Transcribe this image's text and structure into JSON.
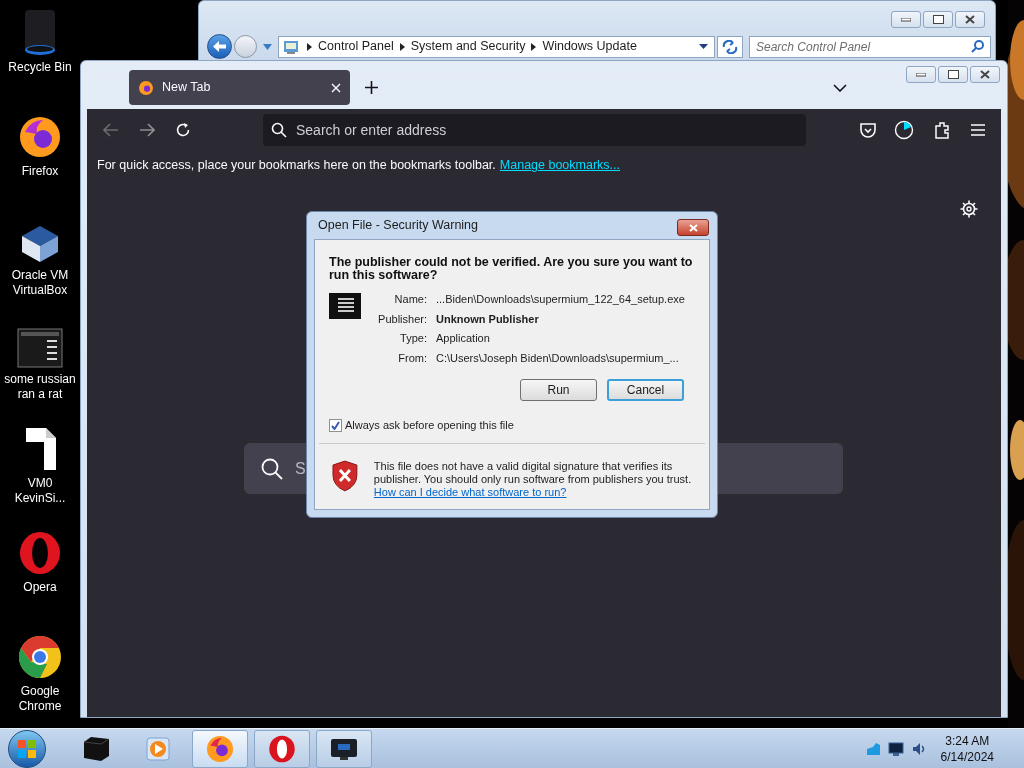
{
  "desktop_icons": [
    {
      "kind": "recycle",
      "label": "Recycle Bin"
    },
    {
      "kind": "firefox",
      "label": "Firefox"
    },
    {
      "kind": "virtualbox",
      "label": "Oracle VM VirtualBox"
    },
    {
      "kind": "console",
      "label": "some russian ran a rat"
    },
    {
      "kind": "document",
      "label": "VM0 KevinSi..."
    },
    {
      "kind": "opera",
      "label": "Opera"
    },
    {
      "kind": "chrome",
      "label": "Google Chrome"
    }
  ],
  "control_panel": {
    "breadcrumb": [
      "Control Panel",
      "System and Security",
      "Windows Update"
    ],
    "search": {
      "placeholder": "Search Control Panel"
    }
  },
  "browser": {
    "tabs": [
      {
        "label": "New Tab",
        "selected": true
      }
    ],
    "address": {
      "placeholder": "Search or enter address"
    },
    "bookmarks_bar": {
      "text": "For quick access, place your bookmarks here on the bookmarks toolbar.",
      "link": "Manage bookmarks..."
    },
    "page_search": {
      "placeholder": "S"
    }
  },
  "dialog": {
    "title": "Open File - Security Warning",
    "heading": "The publisher could not be verified. Are you sure you want to run this software?",
    "fields": [
      {
        "label": "Name:",
        "value": "...Biden\\Downloads\\supermium_122_64_setup.exe",
        "bold": false
      },
      {
        "label": "Publisher:",
        "value": "Unknown Publisher",
        "bold": true
      },
      {
        "label": "Type:",
        "value": "Application",
        "bold": false
      },
      {
        "label": "From:",
        "value": "C:\\Users\\Joseph Biden\\Downloads\\supermium_...",
        "bold": false
      }
    ],
    "buttons": [
      {
        "label": "Run",
        "default": false
      },
      {
        "label": "Cancel",
        "default": true
      }
    ],
    "checkbox": {
      "label": "Always ask before opening this file",
      "checked": true
    },
    "warning": "This file does not have a valid digital signature that verifies its publisher. You should only run software from publishers you trust.",
    "help_link": "How can I decide what software to run?"
  },
  "taskbar": {
    "apps": [
      {
        "kind": "cube",
        "active": false,
        "running": false
      },
      {
        "kind": "media",
        "active": false,
        "running": false
      },
      {
        "kind": "firefox",
        "active": true,
        "running": true
      },
      {
        "kind": "opera",
        "active": false,
        "running": true
      },
      {
        "kind": "remote",
        "active": false,
        "running": true
      }
    ],
    "clock": {
      "time": "3:24 AM",
      "date": "6/14/2024"
    }
  }
}
